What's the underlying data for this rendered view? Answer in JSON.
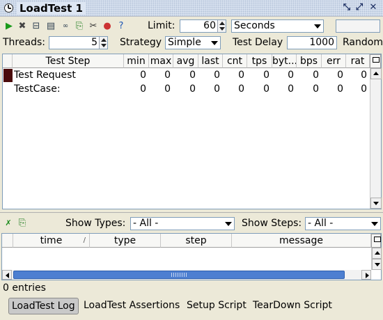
{
  "window": {
    "title": "LoadTest 1"
  },
  "toolbar": {
    "limit_label": "Limit:",
    "limit_value": "60",
    "limit_unit": "Seconds"
  },
  "config": {
    "threads_label": "Threads:",
    "threads_value": "5",
    "strategy_label": "Strategy",
    "strategy_value": "Simple",
    "delay_label": "Test Delay",
    "delay_value": "1000",
    "random_label": "Random"
  },
  "stats": {
    "columns": [
      "Test Step",
      "min",
      "max",
      "avg",
      "last",
      "cnt",
      "tps",
      "byt...",
      "bps",
      "err",
      "rat"
    ],
    "rows": [
      {
        "name": "Test Request",
        "values": [
          "0",
          "0",
          "0",
          "0",
          "0",
          "0",
          "0",
          "0",
          "0",
          "0"
        ]
      },
      {
        "name": "TestCase:",
        "values": [
          "0",
          "0",
          "0",
          "0",
          "0",
          "0",
          "0",
          "0",
          "0",
          "0"
        ]
      }
    ]
  },
  "log_filters": {
    "show_types_label": "Show Types:",
    "show_types_value": "- All -",
    "show_steps_label": "Show Steps:",
    "show_steps_value": "- All -"
  },
  "log": {
    "columns": [
      "time",
      "type",
      "step",
      "message"
    ],
    "entries_text": "0 entries"
  },
  "tabs": [
    "LoadTest Log",
    "LoadTest Assertions",
    "Setup Script",
    "TearDown Script"
  ],
  "colors": {
    "selected_row_marker": "#4a0a0a",
    "active_tab_bg": "#c9c9c9",
    "scrollbar_thumb": "#4d7fd1"
  }
}
